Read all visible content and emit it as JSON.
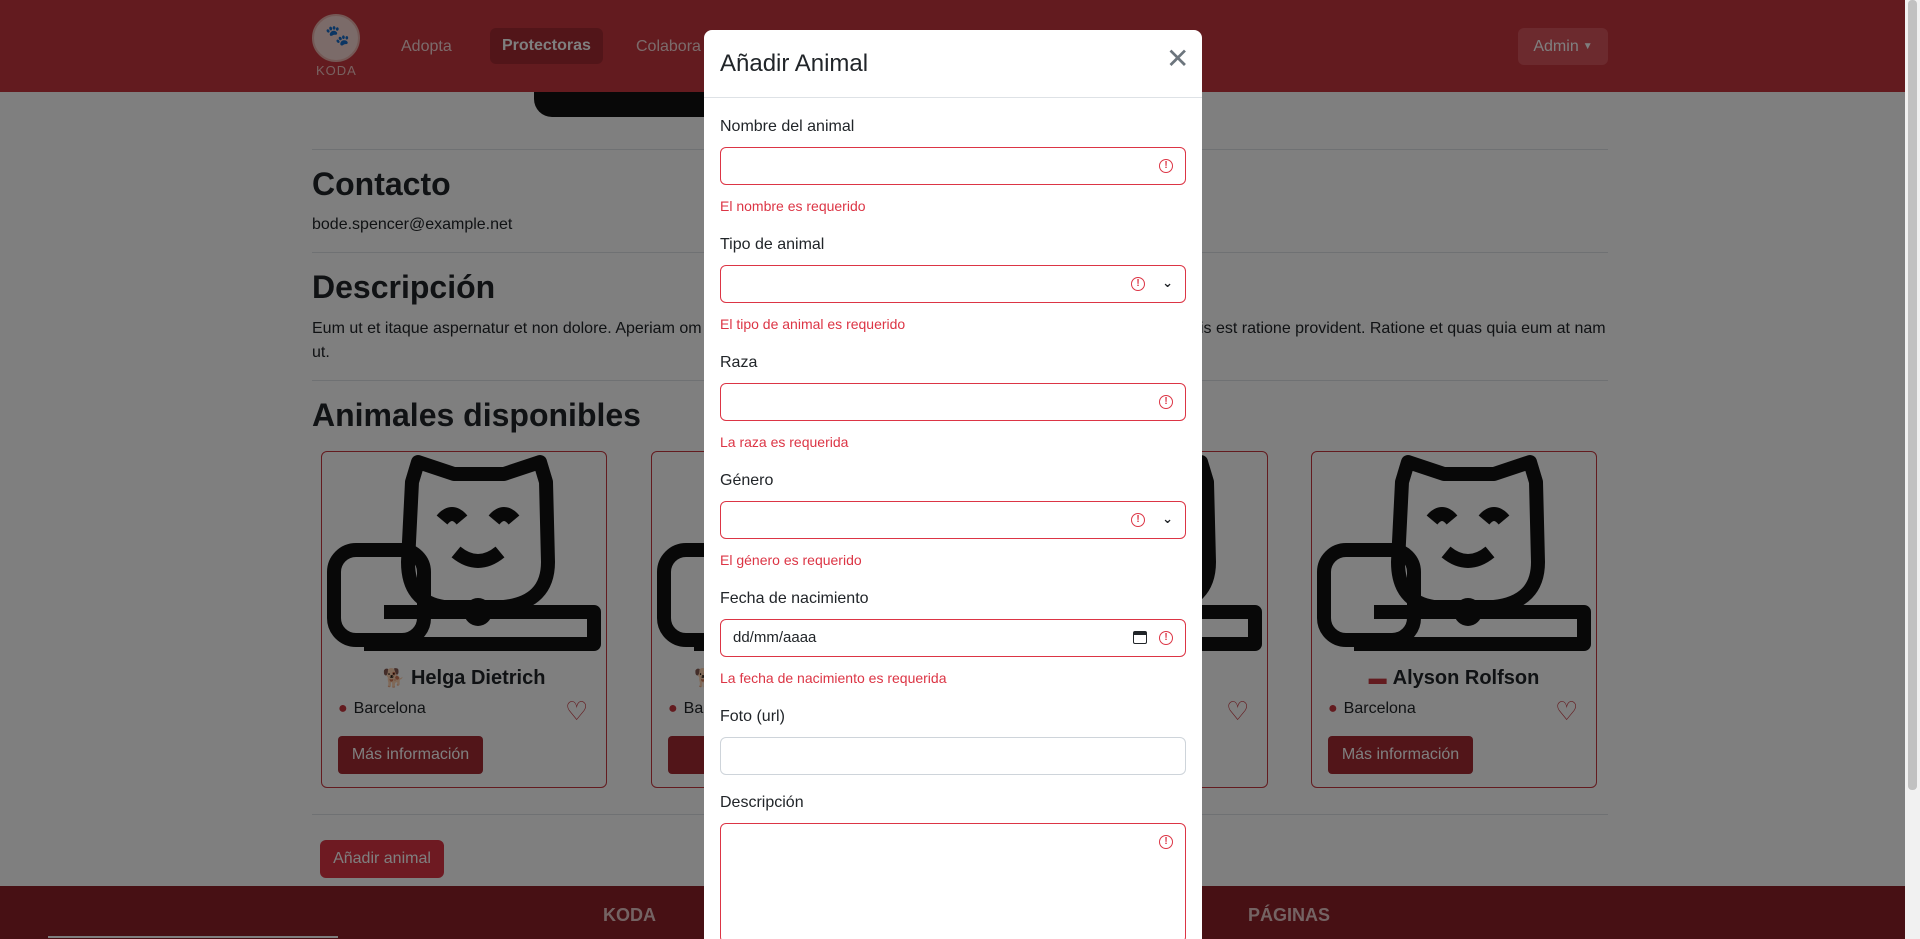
{
  "nav": {
    "logo_text": "KODA",
    "links": [
      "Adopta",
      "Protectoras",
      "Colabora"
    ],
    "admin_label": "Admin"
  },
  "page": {
    "contact_heading": "Contacto",
    "contact_email": "bode.spencer@example.net",
    "description_heading": "Descripción",
    "description_text": "Eum ut et itaque aspernatur et non dolore. Aperiam om",
    "description_text_tail": "is est ratione provident. Ratione et quas quia eum at nam",
    "description_text_line2": "ut.",
    "animals_heading": "Animales disponibles",
    "add_animal_button": "Añadir animal"
  },
  "cards": [
    {
      "name": "Helga Dietrich",
      "type_icon": "dog-icon",
      "location": "Barcelona",
      "button": "Más información"
    },
    {
      "name": "",
      "type_icon": "dog-icon",
      "location": "Ba",
      "button": "Má"
    },
    {
      "name": "",
      "type_icon": "",
      "location": "",
      "button": ""
    },
    {
      "name": "Alyson Rolfson",
      "type_icon": "other-animal-icon",
      "location": "Barcelona",
      "button": "Más información"
    }
  ],
  "footer": {
    "col1": "KODA",
    "col2": "PÁGINAS"
  },
  "modal": {
    "title": "Añadir Animal",
    "fields": {
      "name": {
        "label": "Nombre del animal",
        "error": "El nombre es requerido"
      },
      "type": {
        "label": "Tipo de animal",
        "error": "El tipo de animal es requerido"
      },
      "breed": {
        "label": "Raza",
        "error": "La raza es requerida"
      },
      "gender": {
        "label": "Género",
        "error": "El género es requerido"
      },
      "birth": {
        "label": "Fecha de nacimiento",
        "placeholder": "dd/mm/aaaa",
        "error": "La fecha de nacimiento es requerida"
      },
      "photo": {
        "label": "Foto (url)"
      },
      "description": {
        "label": "Descripción"
      }
    }
  },
  "colors": {
    "brand": "#c7363f",
    "brand_dark": "#a52a32",
    "danger": "#dc3545"
  }
}
